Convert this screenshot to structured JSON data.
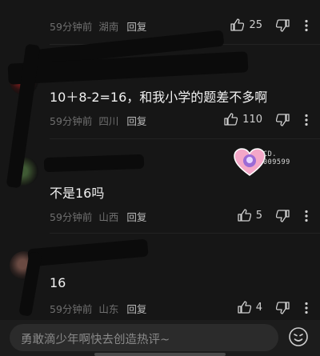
{
  "comments": [
    {
      "text": "",
      "time": "59分钟前",
      "location": "湖南",
      "reply_label": "回复",
      "likes": "25"
    },
    {
      "text": "10＋8-2=16，和我小学的题差不多啊",
      "time": "59分钟前",
      "location": "四川",
      "reply_label": "回复",
      "likes": "110"
    },
    {
      "text": "不是16吗",
      "time": "59分钟前",
      "location": "山西",
      "reply_label": "回复",
      "likes": "5",
      "badge_text_line1": "CD.",
      "badge_text_line2": "009599"
    },
    {
      "text": "16",
      "time": "59分钟前",
      "location": "山东",
      "reply_label": "回复",
      "likes": "4"
    }
  ],
  "composer": {
    "placeholder": "勇敢滴少年啊快去创造热评~"
  },
  "icons": {
    "like": "thumbs-up-icon",
    "dislike": "thumbs-down-icon",
    "more": "more-vertical-icon",
    "emoji": "emoji-icon"
  },
  "colors": {
    "background": "#161616",
    "meta_text": "#6f6f6f",
    "reply_text": "#bdbdbd",
    "content_text": "#f1f1f1",
    "badge_pink": "#f4a7c8",
    "badge_purple": "#9b6bd6"
  }
}
